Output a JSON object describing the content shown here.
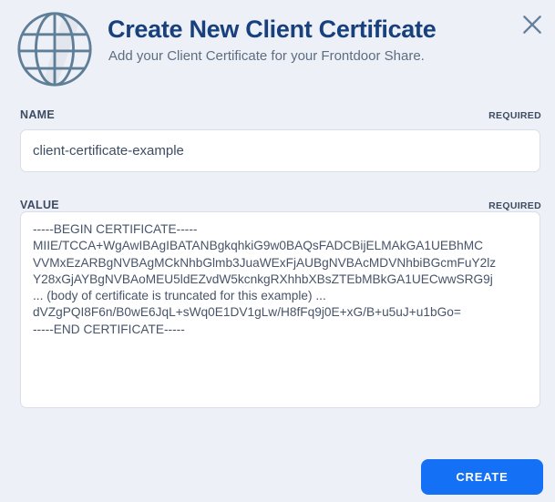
{
  "header": {
    "title": "Create New Client Certificate",
    "subtitle": "Add your Client Certificate for your Frontdoor Share."
  },
  "fields": {
    "name": {
      "label": "NAME",
      "required_badge": "REQUIRED",
      "value": "client-certificate-example"
    },
    "value": {
      "label": "VALUE",
      "required_badge": "REQUIRED",
      "value": "-----BEGIN CERTIFICATE-----\nMIIE/TCCA+WgAwIBAgIBATANBgkqhkiG9w0BAQsFADCBijELMAkGA1UEBhMC\nVVMxEzARBgNVBAgMCkNhbGlmb3JuaWExFjAUBgNVBAcMDVNhbiBGcmFuY2lz\nY28xGjAYBgNVBAoMEU5ldEZvdW5kcnkgRXhhbXBsZTEbMBkGA1UECwwSRG9j\n... (body of certificate is truncated for this example) ...\ndVZgPQI8F6n/B0wE6JqL+sWq0E1DV1gLw/H8fFq9j0E+xG/B+u5uJ+u1bGo=\n-----END CERTIFICATE-----"
    }
  },
  "footer": {
    "create_label": "CREATE"
  },
  "icons": {
    "header_icon": "globe-icon",
    "close": "close-icon"
  },
  "colors": {
    "background": "#eef0f7",
    "title_text": "#17407d",
    "subtitle_text": "#5d6d82",
    "label_text": "#3d4c63",
    "input_border": "#d9deea",
    "icon_stroke": "#5f7f98",
    "create_button": "#1470f5",
    "create_button_text": "#ffffff"
  }
}
